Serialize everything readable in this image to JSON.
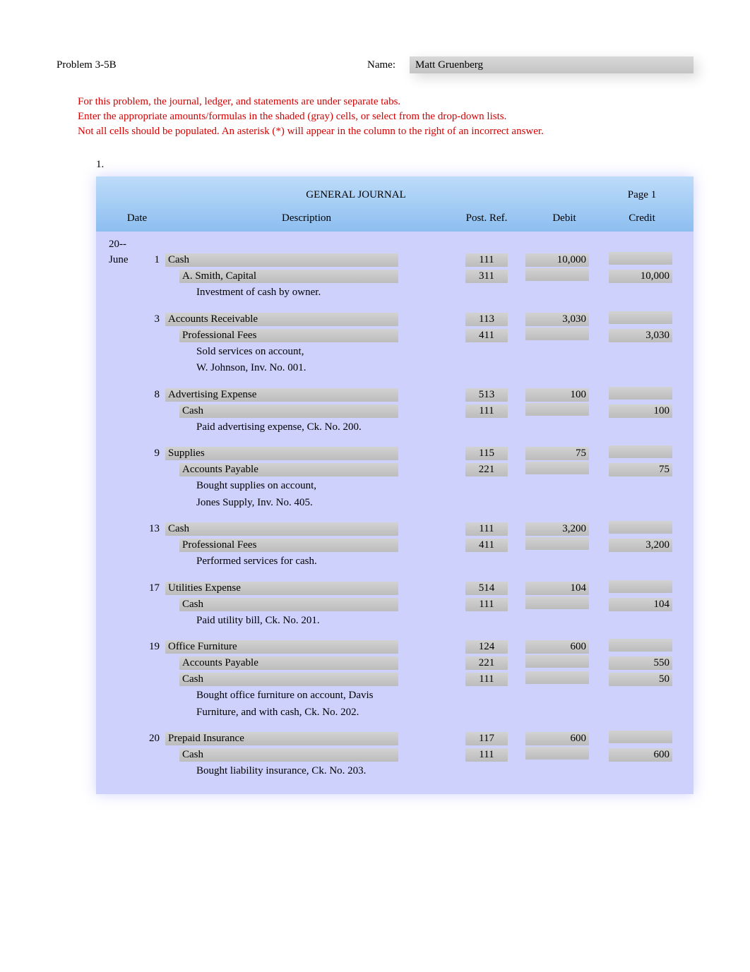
{
  "problem_title": "Problem 3-5B",
  "name_label": "Name:",
  "student_name": "Matt Gruenberg",
  "instructions": [
    "For this problem, the journal, ledger, and statements are under separate tabs.",
    "Enter the appropriate amounts/formulas in the shaded (gray) cells, or select from the drop-down lists.",
    "Not all cells should be populated. An asterisk (*) will appear in the column to the right of an incorrect answer."
  ],
  "section_number": "1.",
  "journal": {
    "title": "GENERAL JOURNAL",
    "page_label": "Page 1",
    "columns": {
      "date": "Date",
      "description": "Description",
      "post_ref": "Post. Ref.",
      "debit": "Debit",
      "credit": "Credit"
    },
    "year_line": "20--",
    "entries": [
      {
        "month": "June",
        "day": "1",
        "lines": [
          {
            "indent": 0,
            "desc": "Cash",
            "post": "111",
            "debit": "10,000",
            "credit": ""
          },
          {
            "indent": 1,
            "desc": "A. Smith, Capital",
            "post": "311",
            "debit": "",
            "credit": "10,000"
          }
        ],
        "memo": [
          "Investment of cash by owner."
        ]
      },
      {
        "month": "",
        "day": "3",
        "lines": [
          {
            "indent": 0,
            "desc": "Accounts Receivable",
            "post": "113",
            "debit": "3,030",
            "credit": ""
          },
          {
            "indent": 1,
            "desc": "Professional Fees",
            "post": "411",
            "debit": "",
            "credit": "3,030"
          }
        ],
        "memo": [
          "Sold services on account,",
          "W. Johnson, Inv. No. 001."
        ]
      },
      {
        "month": "",
        "day": "8",
        "lines": [
          {
            "indent": 0,
            "desc": "Advertising Expense",
            "post": "513",
            "debit": "100",
            "credit": ""
          },
          {
            "indent": 1,
            "desc": "Cash",
            "post": "111",
            "debit": "",
            "credit": "100"
          }
        ],
        "memo": [
          "Paid advertising expense, Ck. No. 200."
        ]
      },
      {
        "month": "",
        "day": "9",
        "lines": [
          {
            "indent": 0,
            "desc": "Supplies",
            "post": "115",
            "debit": "75",
            "credit": ""
          },
          {
            "indent": 1,
            "desc": "Accounts Payable",
            "post": "221",
            "debit": "",
            "credit": "75"
          }
        ],
        "memo": [
          "Bought supplies on account,",
          "Jones Supply, Inv. No. 405."
        ]
      },
      {
        "month": "",
        "day": "13",
        "lines": [
          {
            "indent": 0,
            "desc": "Cash",
            "post": "111",
            "debit": "3,200",
            "credit": ""
          },
          {
            "indent": 1,
            "desc": "Professional Fees",
            "post": "411",
            "debit": "",
            "credit": "3,200"
          }
        ],
        "memo": [
          "Performed services for cash."
        ]
      },
      {
        "month": "",
        "day": "17",
        "lines": [
          {
            "indent": 0,
            "desc": "Utilities Expense",
            "post": "514",
            "debit": "104",
            "credit": ""
          },
          {
            "indent": 1,
            "desc": "Cash",
            "post": "111",
            "debit": "",
            "credit": "104"
          }
        ],
        "memo": [
          "Paid utility bill, Ck. No. 201."
        ]
      },
      {
        "month": "",
        "day": "19",
        "lines": [
          {
            "indent": 0,
            "desc": "Office Furniture",
            "post": "124",
            "debit": "600",
            "credit": ""
          },
          {
            "indent": 1,
            "desc": "Accounts Payable",
            "post": "221",
            "debit": "",
            "credit": "550"
          },
          {
            "indent": 1,
            "desc": "Cash",
            "post": "111",
            "debit": "",
            "credit": "50"
          }
        ],
        "memo": [
          "Bought office furniture on account, Davis",
          "Furniture, and with cash, Ck. No. 202."
        ]
      },
      {
        "month": "",
        "day": "20",
        "lines": [
          {
            "indent": 0,
            "desc": "Prepaid Insurance",
            "post": "117",
            "debit": "600",
            "credit": ""
          },
          {
            "indent": 1,
            "desc": "Cash",
            "post": "111",
            "debit": "",
            "credit": "600"
          }
        ],
        "memo": [
          "Bought liability insurance, Ck. No. 203."
        ]
      }
    ]
  }
}
